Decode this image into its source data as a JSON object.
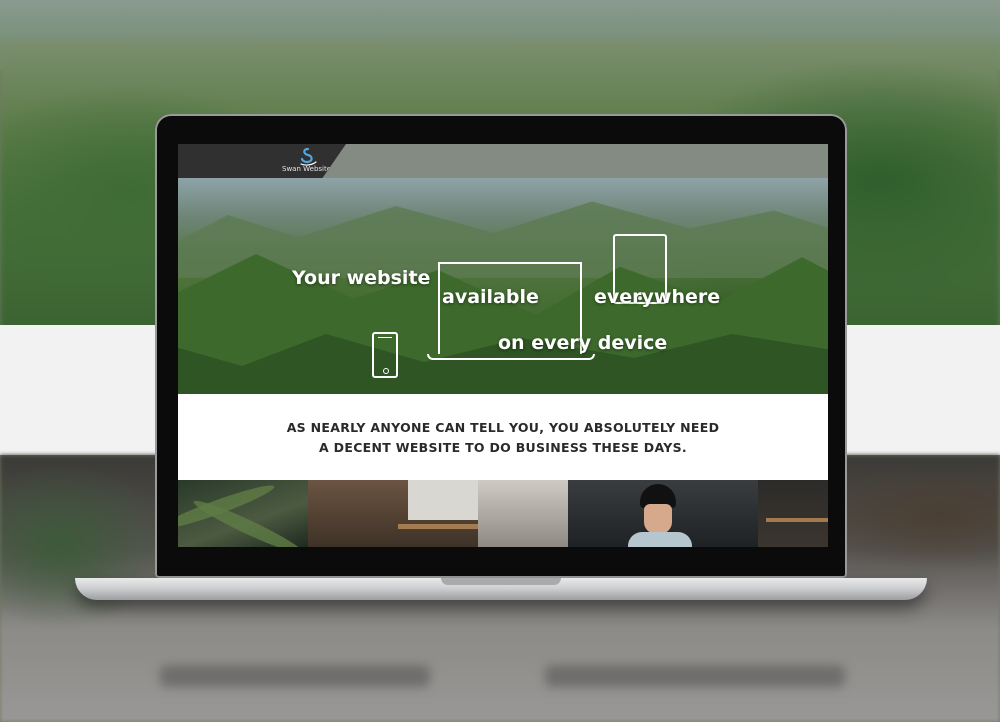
{
  "site": {
    "logo_text": "Swan Websites"
  },
  "hero": {
    "line1": "Your website",
    "line2": "available",
    "line3": "everywhere",
    "line4": "on every device"
  },
  "tagline": {
    "line1": "AS NEARLY ANYONE CAN TELL YOU, YOU ABSOLUTELY NEED",
    "line2": "A DECENT WEBSITE TO DO BUSINESS THESE DAYS."
  },
  "icons": [
    "swan-logo-icon",
    "laptop-outline-icon",
    "tablet-outline-icon",
    "phone-outline-icon"
  ]
}
